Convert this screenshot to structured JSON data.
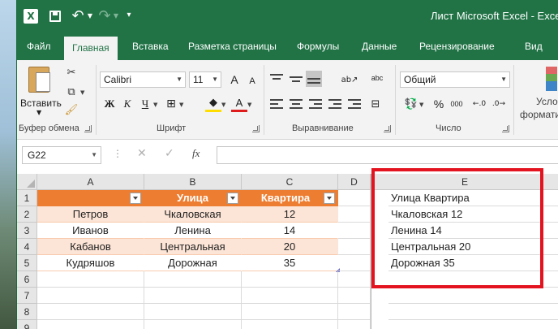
{
  "app": {
    "window_title": "Лист Microsoft Excel  -  Excel",
    "logo_letter": "X"
  },
  "ribbon_tabs": [
    {
      "label": "Файл"
    },
    {
      "label": "Главная",
      "active": true
    },
    {
      "label": "Вставка"
    },
    {
      "label": "Разметка страницы"
    },
    {
      "label": "Формулы"
    },
    {
      "label": "Данные"
    },
    {
      "label": "Рецензирование"
    },
    {
      "label": "Вид"
    }
  ],
  "ribbon": {
    "clipboard": {
      "paste_label": "Вставить",
      "group_label": "Буфер обмена"
    },
    "font": {
      "font_name": "Calibri",
      "font_size": "11",
      "bold": "Ж",
      "italic": "К",
      "underline": "Ч",
      "font_color_glyph": "A",
      "grow_font": "A",
      "shrink_font": "A",
      "group_label": "Шрифт"
    },
    "alignment": {
      "group_label": "Выравнивание",
      "wrap_glyph": "abc"
    },
    "number": {
      "format": "Общий",
      "group_label": "Число",
      "percent": "%",
      "thousands": "000"
    },
    "styles": {
      "conditional_label": "Усло",
      "format_label": "формати"
    }
  },
  "formula_bar": {
    "name_box": "G22",
    "fx": "fx",
    "cancel_glyph": "✕",
    "enter_glyph": "✓",
    "formula_value": ""
  },
  "colors": {
    "accent": "#217346",
    "table_header": "#ed7d31",
    "table_band": "#fce4d6",
    "highlight_frame": "#e3141f"
  },
  "grid": {
    "columns": [
      "A",
      "B",
      "C",
      "D",
      "E"
    ],
    "rows": [
      "1",
      "2",
      "3",
      "4",
      "5",
      "6",
      "7",
      "8",
      "9"
    ],
    "table": {
      "headers": [
        "",
        "Улица",
        "Квартира"
      ],
      "rows": [
        [
          "Петров",
          "Чкаловская",
          "12"
        ],
        [
          "Иванов",
          "Ленина",
          "14"
        ],
        [
          "Кабанов",
          "Центральная",
          "20"
        ],
        [
          "Кудряшов",
          "Дорожная",
          "35"
        ]
      ]
    },
    "column_e": [
      "Улица Квартира",
      "Чкаловская 12",
      "Ленина 14",
      "Центральная 20",
      "Дорожная 35"
    ]
  }
}
